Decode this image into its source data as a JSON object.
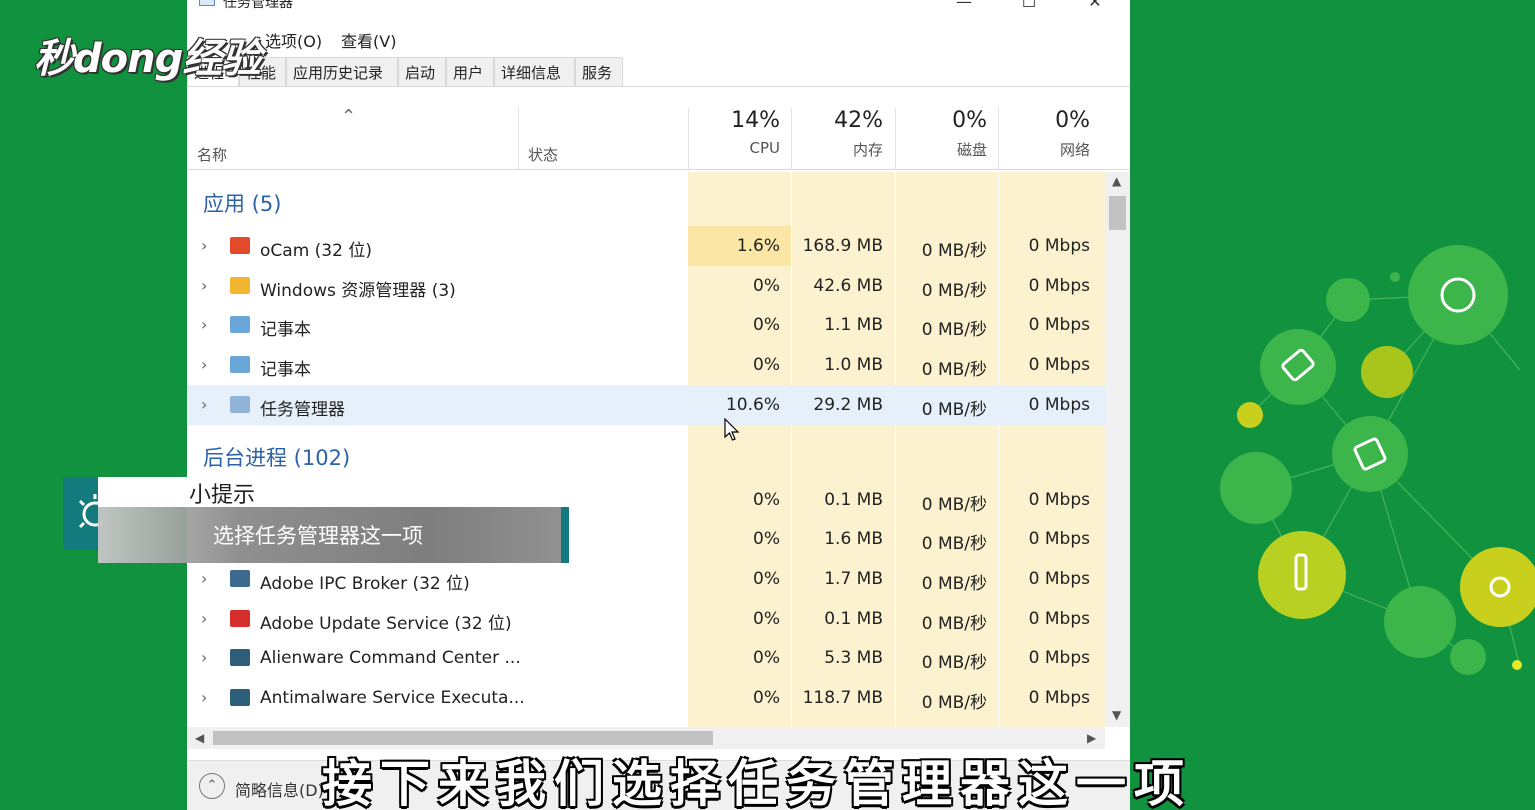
{
  "logo": {
    "text": "秒dong经验"
  },
  "window": {
    "title": "任务管理器",
    "controls": {
      "minimize": "—",
      "maximize": "☐",
      "close": "✕"
    },
    "menu": [
      "选项(O)",
      "查看(V)"
    ],
    "tabs": [
      "进程",
      "性能",
      "应用历史记录",
      "启动",
      "用户",
      "详细信息",
      "服务"
    ],
    "active_tab": "进程"
  },
  "columns": {
    "name": "名称",
    "status": "状态",
    "cpu": {
      "pct": "14%",
      "label": "CPU"
    },
    "memory": {
      "pct": "42%",
      "label": "内存"
    },
    "disk": {
      "pct": "0%",
      "label": "磁盘"
    },
    "network": {
      "pct": "0%",
      "label": "网络"
    }
  },
  "groups": {
    "apps": "应用 (5)",
    "background": "后台进程 (102)"
  },
  "apps": [
    {
      "name": "oCam (32 位)",
      "icon": "ocam-icon",
      "cpu": "1.6%",
      "memory": "168.9 MB",
      "disk": "0 MB/秒",
      "network": "0 Mbps",
      "color": "#e24a2b"
    },
    {
      "name": "Windows 资源管理器 (3)",
      "icon": "folder-icon",
      "cpu": "0%",
      "memory": "42.6 MB",
      "disk": "0 MB/秒",
      "network": "0 Mbps",
      "color": "#f2b630"
    },
    {
      "name": "记事本",
      "icon": "notepad-icon",
      "cpu": "0%",
      "memory": "1.1 MB",
      "disk": "0 MB/秒",
      "network": "0 Mbps",
      "color": "#6aa6d8"
    },
    {
      "name": "记事本",
      "icon": "notepad-icon",
      "cpu": "0%",
      "memory": "1.0 MB",
      "disk": "0 MB/秒",
      "network": "0 Mbps",
      "color": "#6aa6d8"
    },
    {
      "name": "任务管理器",
      "icon": "task-manager-icon",
      "cpu": "10.6%",
      "memory": "29.2 MB",
      "disk": "0 MB/秒",
      "network": "0 Mbps",
      "color": "#8fb4d8"
    }
  ],
  "background": [
    {
      "name": "",
      "icon": "",
      "cpu": "0%",
      "memory": "0.1 MB",
      "disk": "0 MB/秒",
      "network": "0 Mbps",
      "color": "#ffffff"
    },
    {
      "name": "",
      "icon": "",
      "cpu": "0%",
      "memory": "1.6 MB",
      "disk": "0 MB/秒",
      "network": "0 Mbps",
      "color": "#ffffff"
    },
    {
      "name": "Adobe IPC Broker (32 位)",
      "icon": "adobe-ipc-icon",
      "cpu": "0%",
      "memory": "1.7 MB",
      "disk": "0 MB/秒",
      "network": "0 Mbps",
      "color": "#3d6b8f"
    },
    {
      "name": "Adobe Update Service (32 位)",
      "icon": "adobe-update-icon",
      "cpu": "0%",
      "memory": "0.1 MB",
      "disk": "0 MB/秒",
      "network": "0 Mbps",
      "color": "#d62d2d"
    },
    {
      "name": "Alienware Command Center ...",
      "icon": "alienware-icon",
      "cpu": "0%",
      "memory": "5.3 MB",
      "disk": "0 MB/秒",
      "network": "0 Mbps",
      "color": "#2e5f7a"
    },
    {
      "name": "Antimalware Service Executa...",
      "icon": "antimalware-icon",
      "cpu": "0%",
      "memory": "118.7 MB",
      "disk": "0 MB/秒",
      "network": "0 Mbps",
      "color": "#2e5f7a"
    }
  ],
  "footer": {
    "label": "简略信息(D)"
  },
  "tip": {
    "title": "小提示",
    "text": "选择任务管理器这一项"
  },
  "subtitle": "接下来我们选择任务管理器这一项",
  "colors": {
    "background": "#10923f",
    "heat": "#fdf2cf",
    "group_text": "#2c63a8",
    "tip_accent": "#137b7e"
  }
}
